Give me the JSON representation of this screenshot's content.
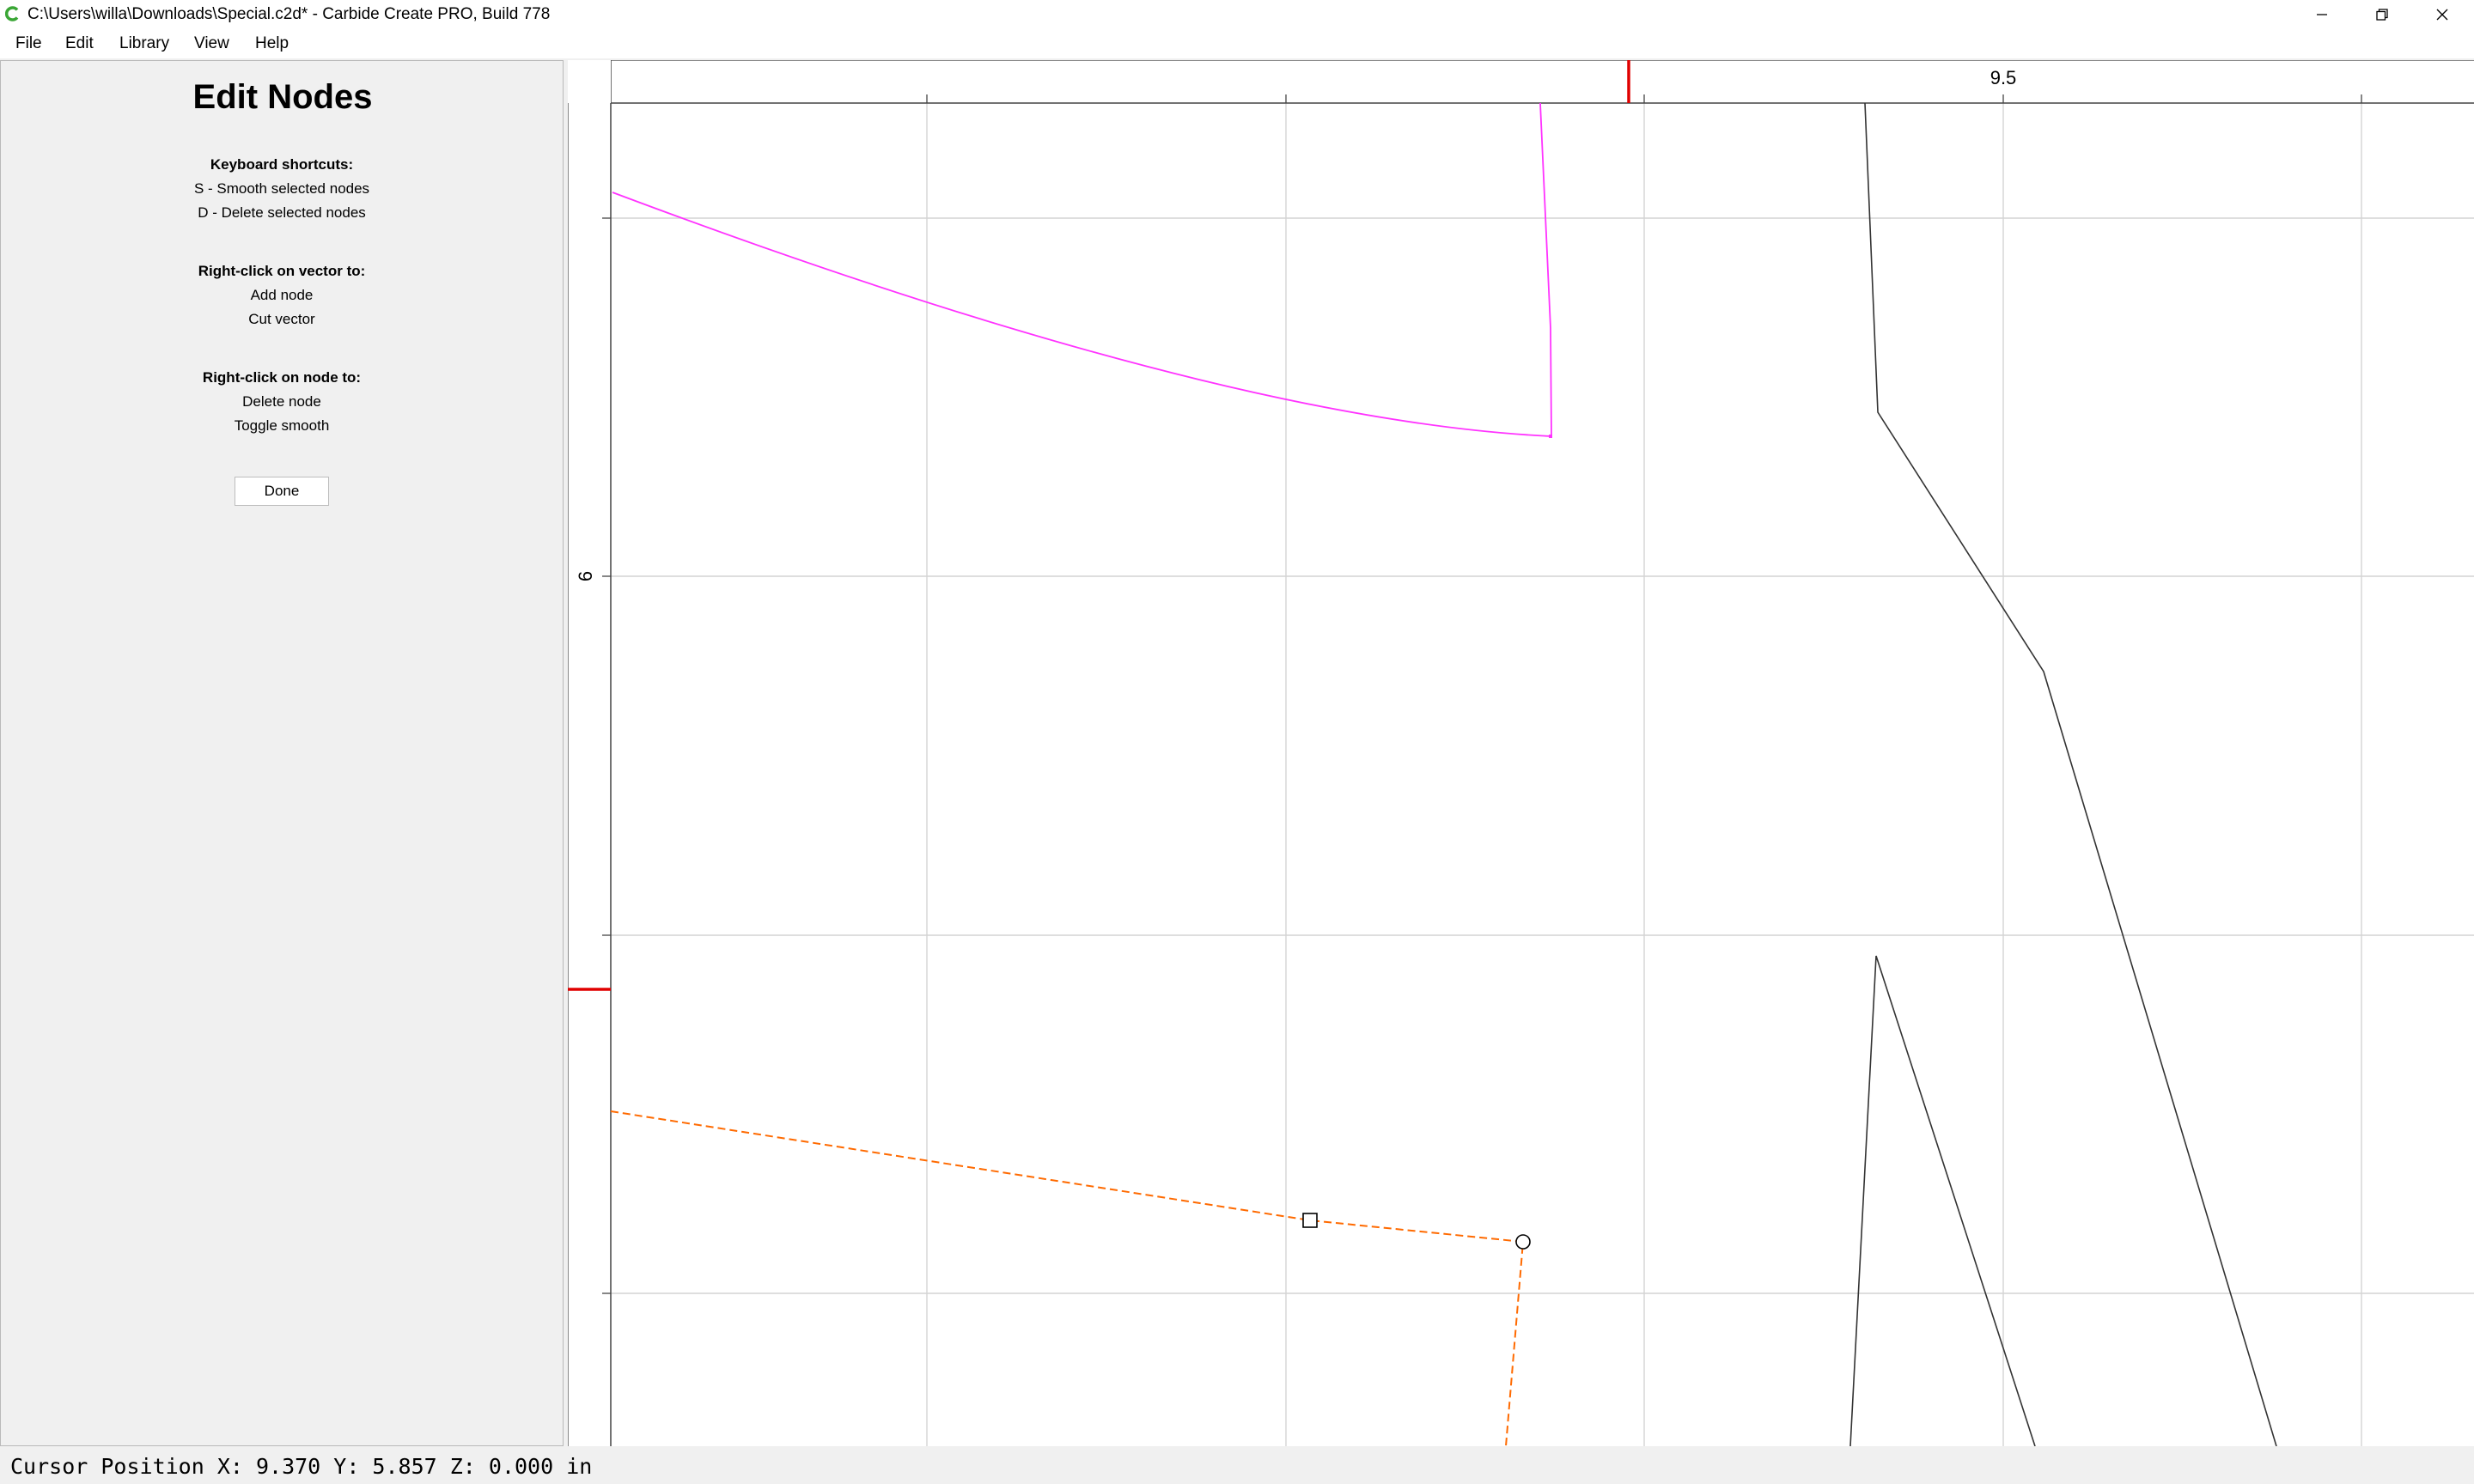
{
  "window": {
    "title": "C:\\Users\\willa\\Downloads\\Special.c2d* - Carbide Create PRO, Build 778",
    "app_icon": "carbide-c-icon",
    "accent": "#3aa635"
  },
  "menu": {
    "items": [
      {
        "label": "File"
      },
      {
        "label": "Edit"
      },
      {
        "label": "Library"
      },
      {
        "label": "View"
      },
      {
        "label": "Help"
      }
    ]
  },
  "panel": {
    "title": "Edit Nodes",
    "shortcuts_heading": "Keyboard shortcuts:",
    "shortcut_smooth": "S - Smooth selected nodes",
    "shortcut_delete": "D - Delete selected nodes",
    "vector_heading": "Right-click on vector to:",
    "vector_add": "Add node",
    "vector_cut": "Cut vector",
    "node_heading": "Right-click on node to:",
    "node_delete": "Delete node",
    "node_toggle": "Toggle smooth",
    "done_label": "Done"
  },
  "canvas": {
    "ruler_top_label": "9.5",
    "ruler_left_label": "6",
    "colors": {
      "selected_vector": "#ff33ff",
      "edit_vector": "#ff6a00",
      "vector": "#333333",
      "grid": "#d4d4d4",
      "cursor_marker": "#e00000"
    }
  },
  "status": {
    "cursor_position": "Cursor Position X: 9.370 Y: 5.857 Z: 0.000 in"
  }
}
